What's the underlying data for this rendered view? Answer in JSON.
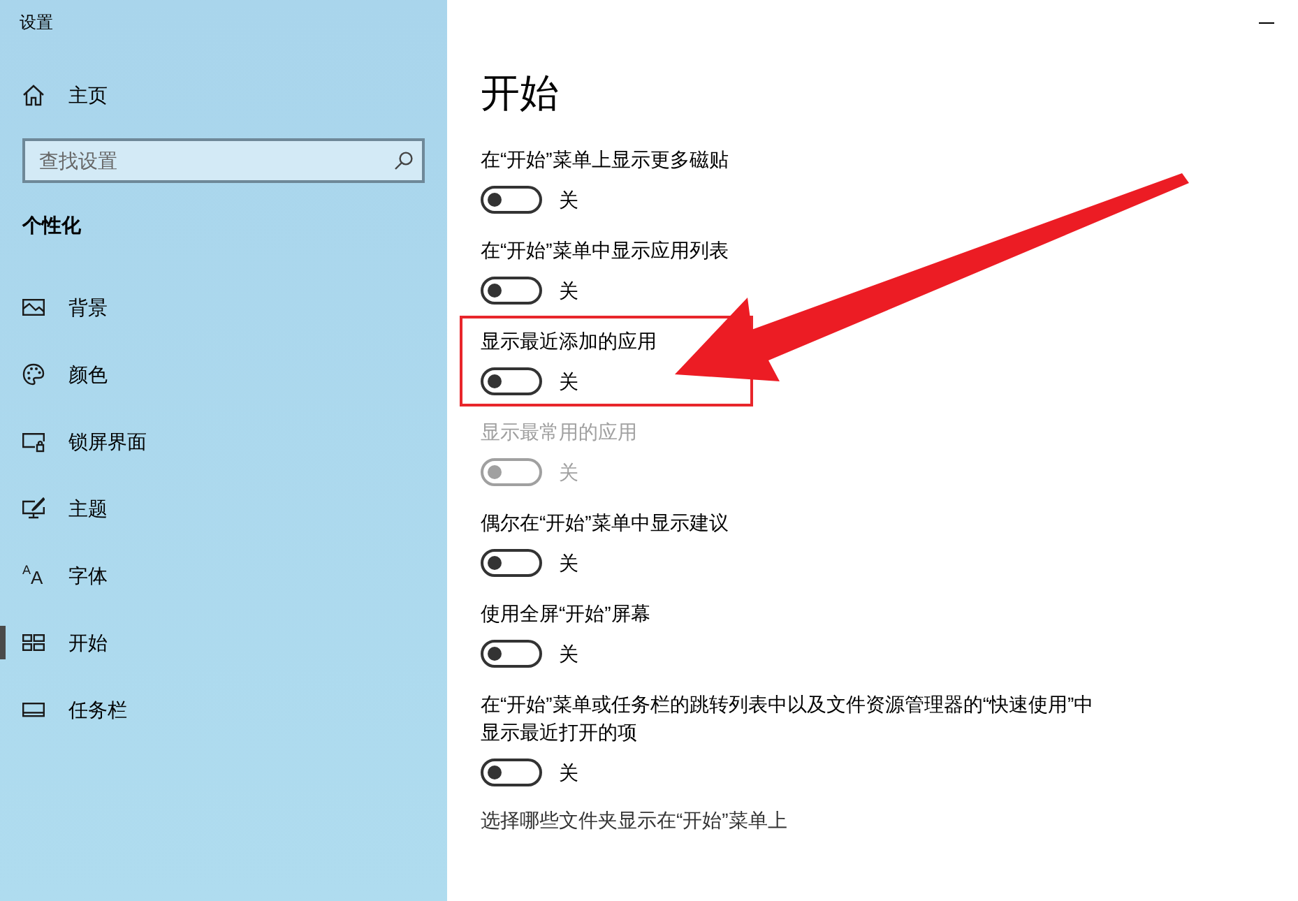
{
  "window": {
    "title": "设置"
  },
  "sidebar": {
    "home": {
      "label": "主页"
    },
    "search": {
      "placeholder": "查找设置"
    },
    "section_title": "个性化",
    "items": [
      {
        "label": "背景",
        "selected": false
      },
      {
        "label": "颜色",
        "selected": false
      },
      {
        "label": "锁屏界面",
        "selected": false
      },
      {
        "label": "主题",
        "selected": false
      },
      {
        "label": "字体",
        "icon_glyph": "AA",
        "selected": false
      },
      {
        "label": "开始",
        "selected": true
      },
      {
        "label": "任务栏",
        "selected": false
      }
    ]
  },
  "main": {
    "heading": "开始",
    "settings": [
      {
        "label": "在“开始”菜单上显示更多磁贴",
        "on": false,
        "state_text": "关",
        "disabled": false,
        "highlighted": false
      },
      {
        "label": "在“开始”菜单中显示应用列表",
        "on": false,
        "state_text": "关",
        "disabled": false,
        "highlighted": false
      },
      {
        "label": "显示最近添加的应用",
        "on": false,
        "state_text": "关",
        "disabled": false,
        "highlighted": true
      },
      {
        "label": "显示最常用的应用",
        "on": false,
        "state_text": "关",
        "disabled": true,
        "highlighted": false
      },
      {
        "label": "偶尔在“开始”菜单中显示建议",
        "on": false,
        "state_text": "关",
        "disabled": false,
        "highlighted": false
      },
      {
        "label": "使用全屏“开始”屏幕",
        "on": false,
        "state_text": "关",
        "disabled": false,
        "highlighted": false
      },
      {
        "label": "在“开始”菜单或任务栏的跳转列表中以及文件资源管理器的“快速使用”中显示最近打开的项",
        "on": false,
        "state_text": "关",
        "disabled": false,
        "highlighted": false
      }
    ],
    "link": "选择哪些文件夹显示在“开始”菜单上"
  }
}
